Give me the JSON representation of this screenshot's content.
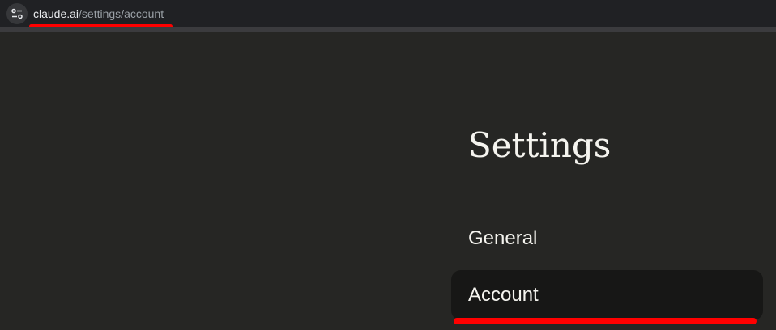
{
  "browser": {
    "url_domain": "claude.ai",
    "url_path": "/settings/account",
    "site_info_icon": "tune-icon",
    "highlight_color": "#ff0000"
  },
  "settings": {
    "title": "Settings",
    "nav": [
      {
        "label": "General",
        "selected": false
      },
      {
        "label": "Account",
        "selected": true
      }
    ]
  }
}
